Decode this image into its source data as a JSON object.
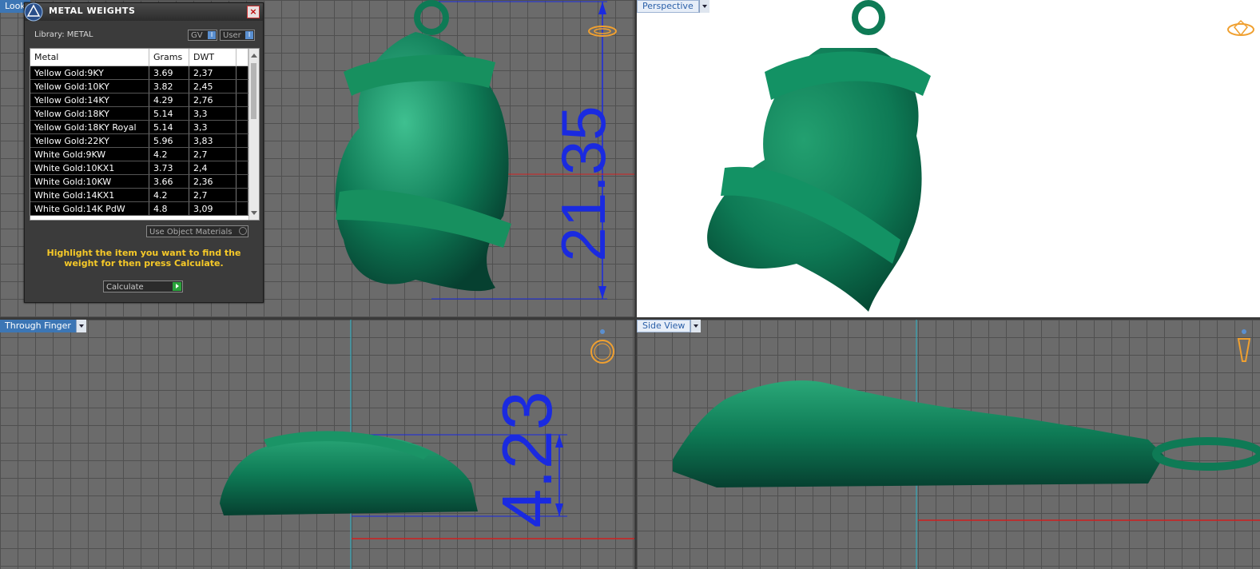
{
  "viewports": {
    "top_left": {
      "label": "Look"
    },
    "top_right": {
      "label": "Perspective"
    },
    "bottom_left": {
      "label": "Through Finger"
    },
    "bottom_right": {
      "label": "Side View"
    }
  },
  "dimensions": {
    "height": "21.35",
    "depth": "4.23"
  },
  "dialog": {
    "title": "METAL WEIGHTS",
    "library": "Library: METAL",
    "toggle_gv": "GV",
    "toggle_user": "User",
    "indicator": "I",
    "columns": [
      "Metal",
      "Grams",
      "DWT"
    ],
    "rows": [
      [
        "Yellow Gold:9KY",
        "3.69",
        "2,37"
      ],
      [
        "Yellow Gold:10KY",
        "3.82",
        "2,45"
      ],
      [
        "Yellow Gold:14KY",
        "4.29",
        "2,76"
      ],
      [
        "Yellow Gold:18KY",
        "5.14",
        "3,3"
      ],
      [
        "Yellow Gold:18KY Royal",
        "5.14",
        "3,3"
      ],
      [
        "Yellow Gold:22KY",
        "5.96",
        "3,83"
      ],
      [
        "White Gold:9KW",
        "4.2",
        "2,7"
      ],
      [
        "White Gold:10KX1",
        "3.73",
        "2,4"
      ],
      [
        "White Gold:10KW",
        "3.66",
        "2,36"
      ],
      [
        "White Gold:14KX1",
        "4.2",
        "2,7"
      ],
      [
        "White Gold:14K PdW",
        "4.8",
        "3,09"
      ]
    ],
    "use_object_materials": "Use Object Materials",
    "hint": "Highlight the item you want to find the weight for then press Calculate.",
    "calculate": "Calculate"
  },
  "colors": {
    "model": "#0e7a55",
    "dimension": "#1a2ae0",
    "axis": "#d02020",
    "nav": "#f0a030"
  }
}
